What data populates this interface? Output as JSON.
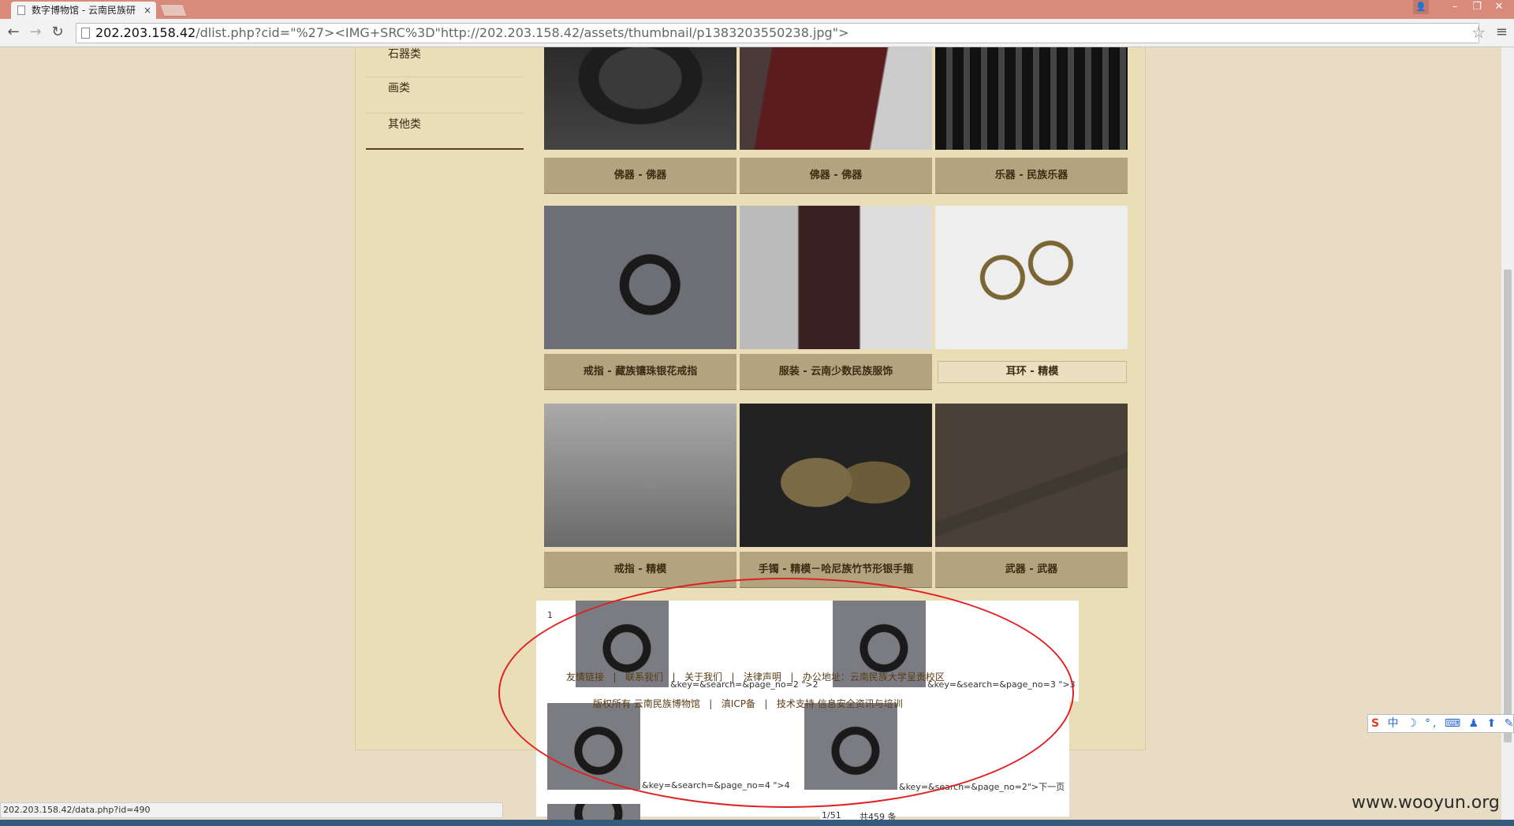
{
  "browser": {
    "tab_title": "数字博物馆 - 云南民族研",
    "tab_close": "×",
    "url_host": "202.203.158.42",
    "url_path": "/dlist.php?cid=\"%27><IMG+SRC%3D\"http://202.203.158.42/assets/thumbnail/p1383203550238.jpg\">",
    "status_url": "202.203.158.42/data.php?id=490",
    "back": "←",
    "forward": "→",
    "reload": "↻",
    "star": "☆",
    "menu": "≡",
    "minimize": "–",
    "restore": "❐",
    "close": "✕",
    "user": "👤"
  },
  "sidebar": {
    "items": [
      {
        "label": "石器类"
      },
      {
        "label": "画类"
      },
      {
        "label": "其他类"
      }
    ]
  },
  "grid": {
    "rows": [
      [
        {
          "caption": "佛器 - 佛器",
          "icon": "vase-photo"
        },
        {
          "caption": "佛器 - 佛器",
          "icon": "box-photo"
        },
        {
          "caption": "乐器 - 民族乐器",
          "icon": "instrument-photo"
        }
      ],
      [
        {
          "caption": "戒指 - 藏族镶珠银花戒指",
          "icon": "ring-photo"
        },
        {
          "caption": "服装 - 云南少数民族服饰",
          "icon": "cloth-photo"
        },
        {
          "caption": "耳环 - 精模",
          "icon": "earring-photo"
        }
      ],
      [
        {
          "caption": "戒指 - 精模",
          "icon": "small-ring-photo"
        },
        {
          "caption": "手镯 - 精模－哈尼族竹节形银手箍",
          "icon": "bracelet-photo"
        },
        {
          "caption": "武器 - 武器",
          "icon": "weapon-photo"
        }
      ]
    ]
  },
  "injected": {
    "page_one": "1",
    "frag_page2": "&key=&search=&page_no=2 \">2",
    "frag_page3": "&key=&search=&page_no=3 \">3",
    "frag_page4": "&key=&search=&page_no=4 \">4",
    "frag_next": "&key=&search=&page_no=2\">下一页",
    "page_count": "1/51",
    "total": "共459 条",
    "footer_links": {
      "friends": "友情链接",
      "contact": "联系我们",
      "about": "关于我们",
      "legal": "法律声明",
      "address": "办公地址：云南民族大学呈贡校区",
      "sep": "|"
    },
    "copyright": "版权所有 云南民族博物馆",
    "icp": "滇ICP备",
    "support": "技术支持 信息安全资讯与培训"
  },
  "ime": {
    "logo": "S",
    "icons": "中 ☽ °, ⌨ ♟ ⬆ ✎"
  },
  "watermark": "www.wooyun.org"
}
